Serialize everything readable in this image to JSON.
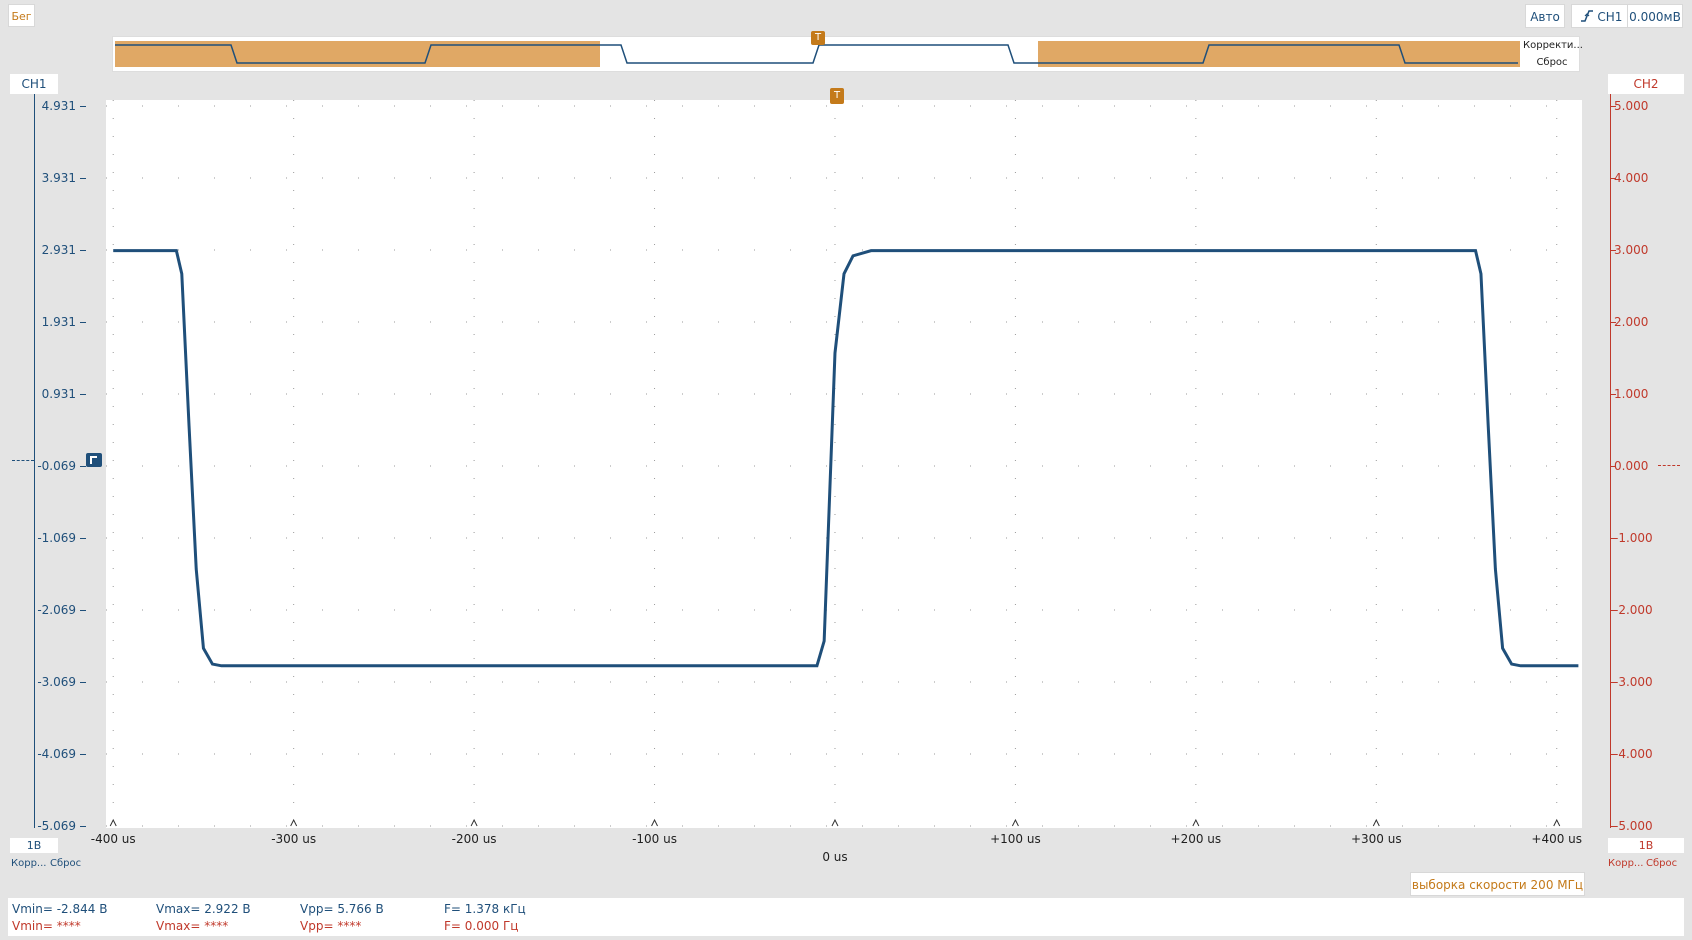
{
  "toolbar": {
    "run_label": "Бег",
    "mode_label": "Авто",
    "trigger_channel": "CH1",
    "trigger_level": "0.000мВ"
  },
  "overview": {
    "correct_label": "Корректи...",
    "reset_label": "Сброс",
    "trigger_marker": "T"
  },
  "ch1": {
    "name": "CH1",
    "scale": "1В",
    "correct_label": "Корр...",
    "reset_label": "Сброс",
    "ticks": [
      "4.931",
      "3.931",
      "2.931",
      "1.931",
      "0.931",
      "-0.069",
      "-1.069",
      "-2.069",
      "-3.069",
      "-4.069",
      "-5.069"
    ],
    "color": "#1f4f7a"
  },
  "ch2": {
    "name": "CH2",
    "scale": "1В",
    "correct_label": "Корр...",
    "reset_label": "Сброс",
    "ticks": [
      "5.000",
      "4.000",
      "3.000",
      "2.000",
      "1.000",
      "0.000",
      "-1.000",
      "-2.000",
      "-3.000",
      "-4.000",
      "-5.000"
    ],
    "color": "#c0392b"
  },
  "xaxis": {
    "labels": [
      "-400 us",
      "-300 us",
      "-200 us",
      "-100 us",
      "0 us",
      "+100 us",
      "+200 us",
      "+300 us",
      "+400 us"
    ]
  },
  "sample_rate": "выборка скорости 200 МГц",
  "measurements": {
    "ch1": {
      "vmin": "Vmin= -2.844 В",
      "vmax": "Vmax= 2.922 В",
      "vpp": "Vpp= 5.766 В",
      "freq": "F= 1.378 кГц"
    },
    "ch2": {
      "vmin": "Vmin= ****",
      "vmax": "Vmax= ****",
      "vpp": "Vpp= ****",
      "freq": "F= 0.000 Гц"
    }
  },
  "chart_data": {
    "type": "line",
    "series": [
      {
        "x": [
          -400,
          -365,
          -362,
          -358,
          -354,
          -350,
          -345,
          -340,
          -300,
          -200,
          -100,
          -10,
          -6,
          -3,
          0,
          5,
          10,
          20,
          50,
          100,
          200,
          300,
          355,
          358,
          362,
          366,
          370,
          375,
          380,
          412
        ],
        "values": [
          2.922,
          2.922,
          2.6,
          0.5,
          -1.5,
          -2.6,
          -2.82,
          -2.844,
          -2.844,
          -2.844,
          -2.844,
          -2.844,
          -2.5,
          -0.5,
          1.5,
          2.6,
          2.85,
          2.922,
          2.922,
          2.922,
          2.922,
          2.922,
          2.922,
          2.6,
          0.5,
          -1.5,
          -2.6,
          -2.82,
          -2.844,
          -2.844
        ]
      }
    ],
    "xlim": [
      -404,
      414
    ],
    "ylim_ch1": [
      -5.069,
      4.931
    ],
    "ylim_ch2": [
      -5.0,
      5.0
    ]
  }
}
